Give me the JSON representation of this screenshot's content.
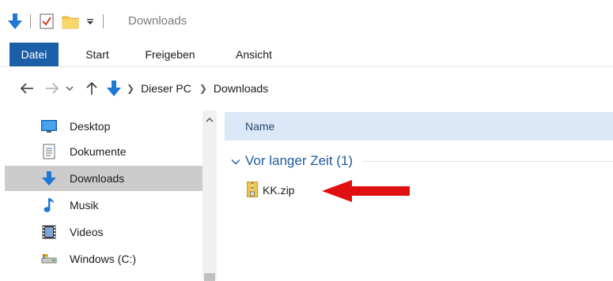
{
  "titlebar": {
    "title": "Downloads",
    "icons": [
      "downloads-arrow-icon",
      "properties-check-icon",
      "new-folder-icon",
      "customize-dropdown-icon"
    ]
  },
  "ribbon": {
    "tabs": [
      {
        "label": "Datei",
        "active": true
      },
      {
        "label": "Start"
      },
      {
        "label": "Freigeben"
      },
      {
        "label": "Ansicht"
      }
    ]
  },
  "address": {
    "crumbs": [
      "Dieser PC",
      "Downloads"
    ]
  },
  "navpane": {
    "items": [
      {
        "label": "Desktop",
        "icon": "desktop-icon"
      },
      {
        "label": "Dokumente",
        "icon": "documents-icon"
      },
      {
        "label": "Downloads",
        "icon": "downloads-icon",
        "selected": true
      },
      {
        "label": "Musik",
        "icon": "music-icon"
      },
      {
        "label": "Videos",
        "icon": "videos-icon"
      },
      {
        "label": "Windows (C:)",
        "icon": "drive-icon"
      }
    ]
  },
  "content": {
    "column_name": "Name",
    "group_title": "Vor langer Zeit (1)",
    "files": [
      {
        "name": "KK.zip",
        "icon": "zip-folder-icon"
      }
    ]
  },
  "colors": {
    "file_tab": "#1b5fa8",
    "group_title": "#1e5a99",
    "header_bg": "#dbe8f7",
    "selected_bg": "#cccccc",
    "arrow": "#e01010"
  }
}
